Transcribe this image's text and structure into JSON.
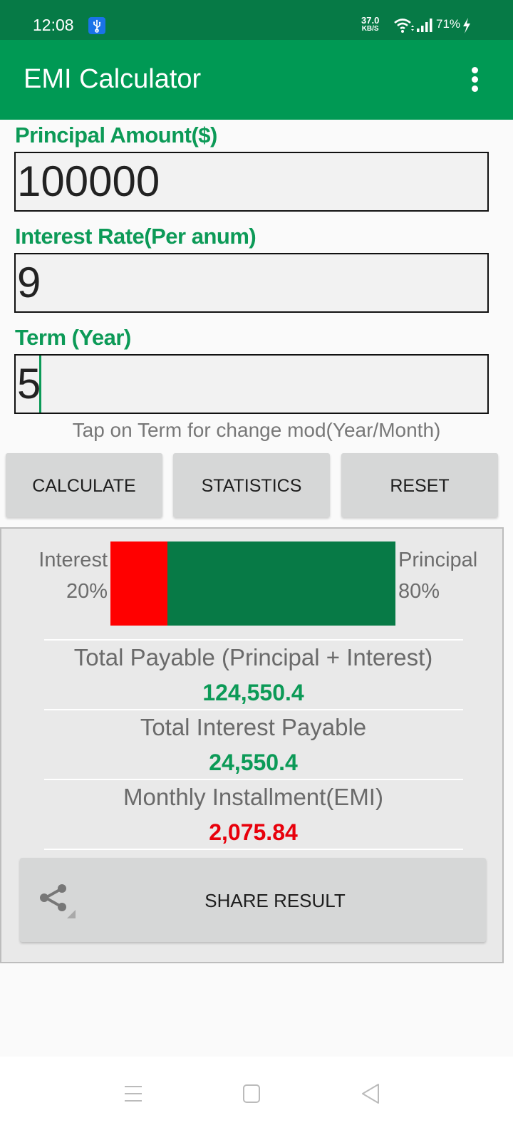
{
  "status_bar": {
    "time": "12:08",
    "net_speed_value": "37.0",
    "net_speed_unit": "KB/S",
    "battery": "71%",
    "icons": [
      "usb-icon",
      "wifi-icon",
      "signal-icon",
      "charging-icon"
    ]
  },
  "app_bar": {
    "title": "EMI Calculator",
    "menu_icon": "overflow-menu-icon"
  },
  "form": {
    "principal": {
      "label": "Principal Amount($)",
      "value": "100000"
    },
    "interest": {
      "label": "Interest Rate(Per anum)",
      "value": "9"
    },
    "term": {
      "label": "Term (Year)",
      "value": "5"
    },
    "hint": "Tap on Term for change mod(Year/Month)"
  },
  "buttons": {
    "calculate": "CALCULATE",
    "statistics": "STATISTICS",
    "reset": "RESET"
  },
  "ratio": {
    "interest_label": "Interest",
    "interest_pct_text": "20%",
    "interest_fraction": 0.2,
    "principal_label": "Principal",
    "principal_pct_text": "80%",
    "principal_fraction": 0.8,
    "colors": {
      "interest": "#ff0000",
      "principal": "#077a46"
    }
  },
  "results": {
    "total_payable": {
      "label": "Total Payable (Principal + Interest)",
      "value": "124,550.4",
      "color": "#0c9a57"
    },
    "total_interest": {
      "label": "Total Interest Payable",
      "value": "24,550.4",
      "color": "#0c9a57"
    },
    "emi": {
      "label": "Monthly Installment(EMI)",
      "value": "2,075.84",
      "color": "#e8000b"
    }
  },
  "share": {
    "label": "SHARE RESULT",
    "icon": "share-icon"
  },
  "nav_bar": {
    "items": [
      "recents-icon",
      "home-icon",
      "back-icon"
    ]
  }
}
